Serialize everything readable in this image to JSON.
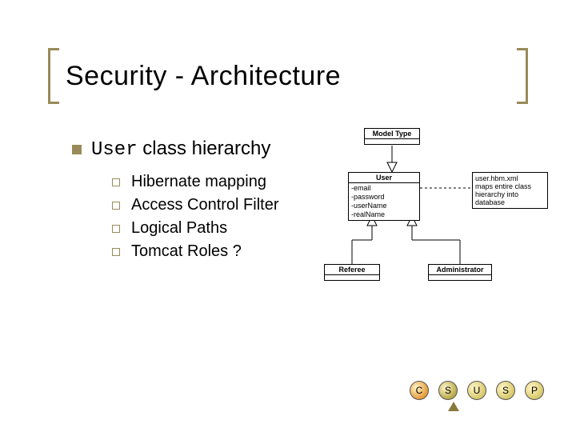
{
  "title": "Security - Architecture",
  "main": {
    "code": "User",
    "rest": " class hierarchy"
  },
  "sub": [
    "Hibernate mapping",
    "Access Control Filter",
    "Logical Paths",
    "Tomcat Roles ?"
  ],
  "uml": {
    "modeltype": "Model Type",
    "user": {
      "name": "User",
      "fields": [
        "-email",
        "-password",
        "-userName",
        "-realName"
      ]
    },
    "referee": "Referee",
    "admin": "Administrator",
    "note": [
      "user.hbm.xml",
      "maps entire class",
      "hierarchy into",
      "database"
    ]
  },
  "dots": [
    {
      "t": "C",
      "c": "#e69a3a"
    },
    {
      "t": "S",
      "c": "#b8a84a"
    },
    {
      "t": "U",
      "c": "#d8c86a"
    },
    {
      "t": "S",
      "c": "#d8c86a"
    },
    {
      "t": "P",
      "c": "#d8c86a"
    }
  ]
}
